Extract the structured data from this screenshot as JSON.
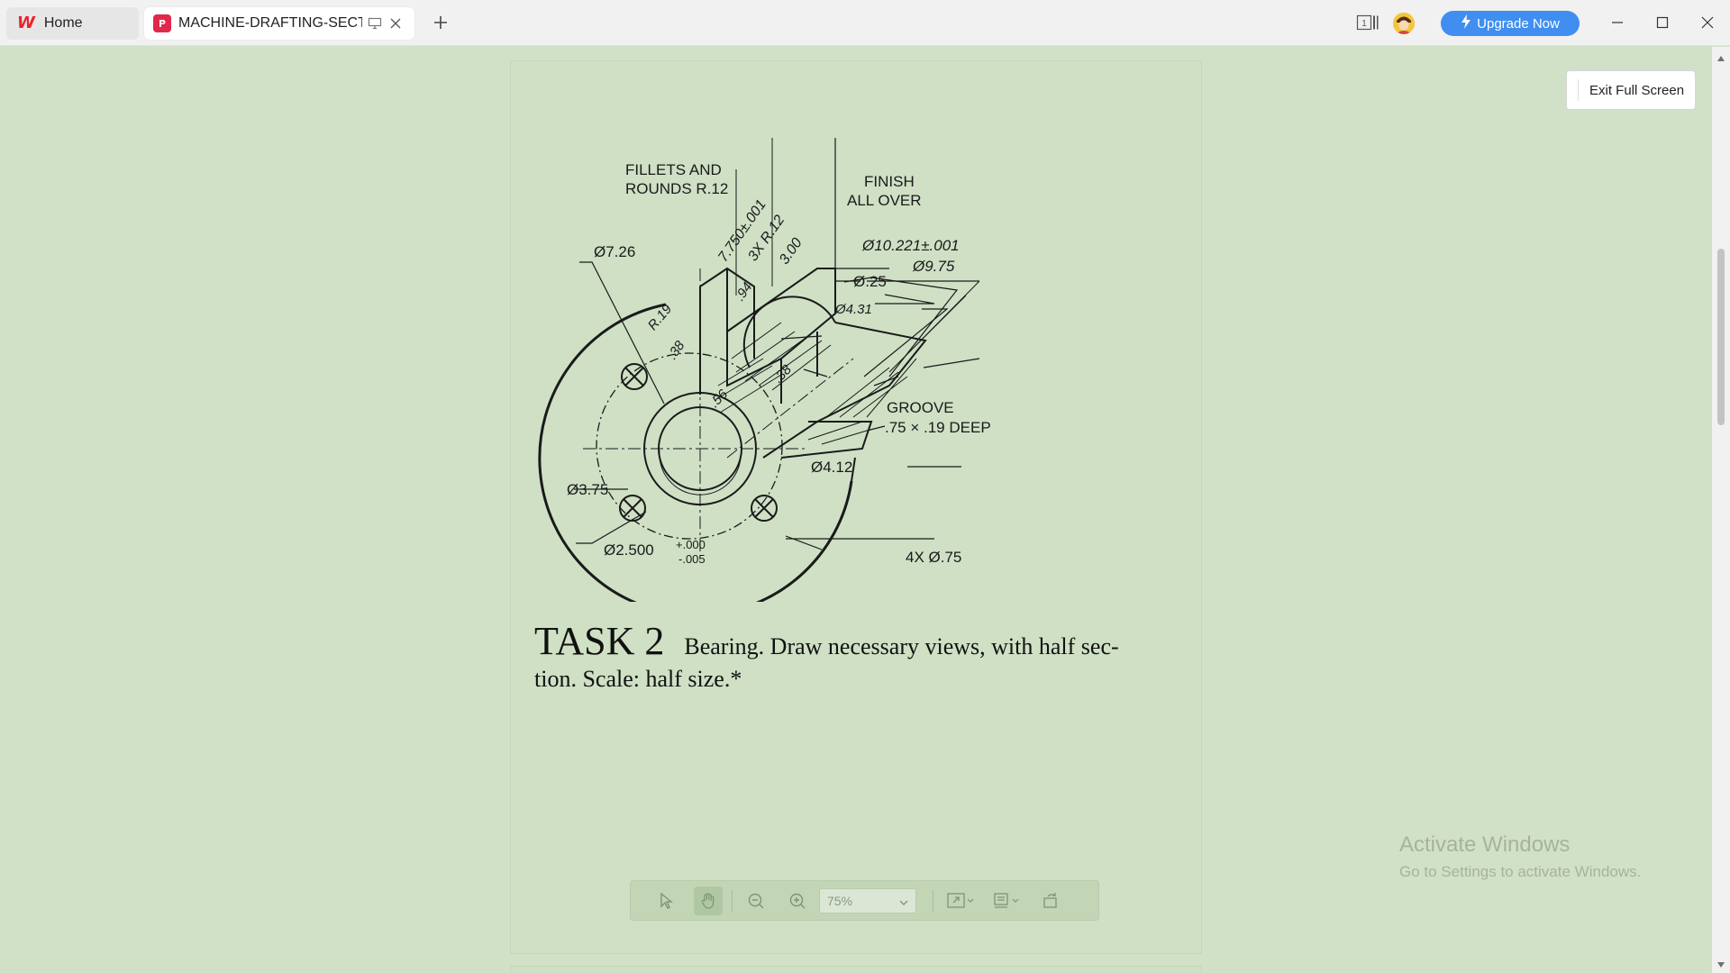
{
  "tabs": [
    {
      "label": "Home",
      "icon": "wps-logo"
    },
    {
      "label": "MACHINE-DRAFTING-SECTION",
      "icon": "pdf-logo"
    }
  ],
  "header": {
    "upgrade_label": "Upgrade Now",
    "view_count": "1"
  },
  "exit_fullscreen_label": "Exit Full Screen",
  "drawing": {
    "labels": {
      "fillets": "FILLETS AND",
      "rounds": "ROUNDS R.12",
      "finish1": "FINISH",
      "finish2": "ALL OVER",
      "d726": "Ø7.26",
      "d10221": "Ø10.221±.001",
      "d975": "Ø9.75",
      "d25": "Ø.25",
      "d431": "Ø4.31",
      "r19": "R.19",
      "v38a": ".38",
      "v94": ".94",
      "v7750": "7.750±.001",
      "v3xr12": "3X R.12",
      "v300": "3.00",
      "v56": ".56",
      "v38b": ".38",
      "d375": "Ø3.75",
      "groove1": "GROOVE",
      "groove2": ".75 × .19 DEEP",
      "d412": "Ø4.12",
      "d2500": "Ø2.500",
      "tol_plus": "+.000",
      "tol_minus": "-.005",
      "holes": "4X Ø.75"
    }
  },
  "task": {
    "title": "TASK 2",
    "desc_line1": "Bearing. Draw necessary views, with half sec-",
    "desc_line2": "tion. Scale: half size.*"
  },
  "toolbar": {
    "zoom_value": "75%"
  },
  "watermark": {
    "title": "Activate Windows",
    "subtitle": "Go to Settings to activate Windows."
  },
  "colors": {
    "page_bg": "#cfe0c5",
    "upgrade_bg": "#3f8ef0",
    "pdf_brand": "#e0284a",
    "wps_brand": "#e8242a"
  }
}
